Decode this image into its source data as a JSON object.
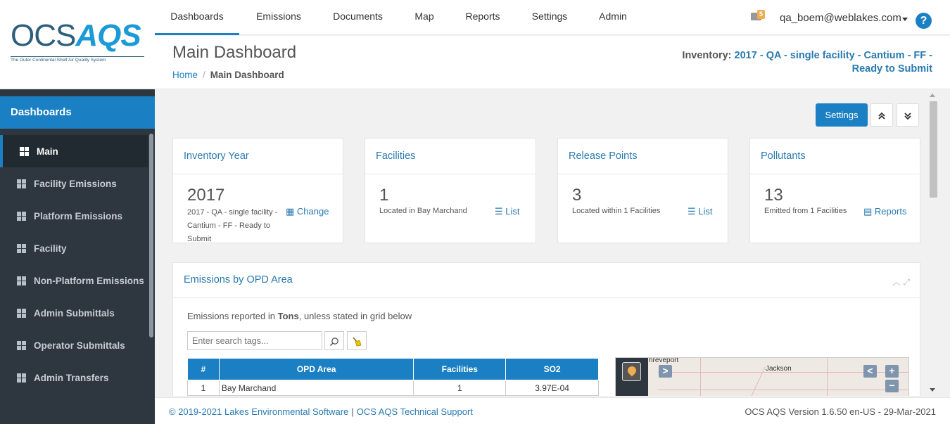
{
  "logo": {
    "ocs": "OCS",
    "aqs": "AQS",
    "tagline": "The Outer Continental Shelf Air Quality System"
  },
  "topnav": {
    "tabs": [
      "Dashboards",
      "Emissions",
      "Documents",
      "Map",
      "Reports",
      "Settings",
      "Admin"
    ],
    "mail_count": "5",
    "user": "qa_boem@weblakes.com",
    "help": "?"
  },
  "sidebar": {
    "section": "Dashboards",
    "items": [
      "Main",
      "Facility Emissions",
      "Platform Emissions",
      "Facility",
      "Non-Platform Emissions",
      "Admin Submittals",
      "Operator Submittals",
      "Admin Transfers"
    ]
  },
  "header": {
    "title": "Main Dashboard",
    "breadcrumb": {
      "home": "Home",
      "separator": "/",
      "current": "Main Dashboard"
    },
    "inventory_label": "Inventory: ",
    "inventory_value": "2017 - QA - single facility - Cantium - FF - Ready to Submit"
  },
  "toolbar": {
    "settings": "Settings",
    "collapse": "⌃",
    "expand": "⌄"
  },
  "cards": {
    "year": {
      "title": "Inventory Year",
      "value": "2017",
      "sub": "2017 - QA - single facility - Cantium - FF - Ready to Submit",
      "action": "Change"
    },
    "facilities": {
      "title": "Facilities",
      "value": "1",
      "sub": "Located in Bay Marchand",
      "action": "List"
    },
    "release": {
      "title": "Release Points",
      "value": "3",
      "sub": "Located within 1 Facilities",
      "action": "List"
    },
    "pollutants": {
      "title": "Pollutants",
      "value": "13",
      "sub": "Emitted from 1 Facilities",
      "action": "Reports"
    }
  },
  "opd": {
    "title": "Emissions by OPD Area",
    "note_pre": "Emissions reported in ",
    "note_unit": "Tons",
    "note_post": ", unless stated in grid below",
    "search_placeholder": "Enter search tags...",
    "columns": [
      "#",
      "OPD Area",
      "Facilities",
      "SO2"
    ],
    "rows": [
      {
        "num": "1",
        "area": "Bay Marchand",
        "facilities": "1",
        "so2": "3.97E-04"
      }
    ]
  },
  "map": {
    "label_city1": "hreveport",
    "label_city2": "Jackson",
    "btn_next": ">",
    "btn_prev": "<",
    "zoom_in": "+",
    "zoom_out": "−"
  },
  "footer": {
    "copyright": "© 2019-2021 Lakes Environmental Software",
    "sep": "|",
    "support": "OCS AQS Technical Support",
    "version": "OCS AQS Version 1.6.50 en-US - 29-Mar-2021"
  },
  "colors": {
    "accent": "#1b80c3",
    "sidebar": "#2e3740",
    "link": "#2a7ab0"
  }
}
